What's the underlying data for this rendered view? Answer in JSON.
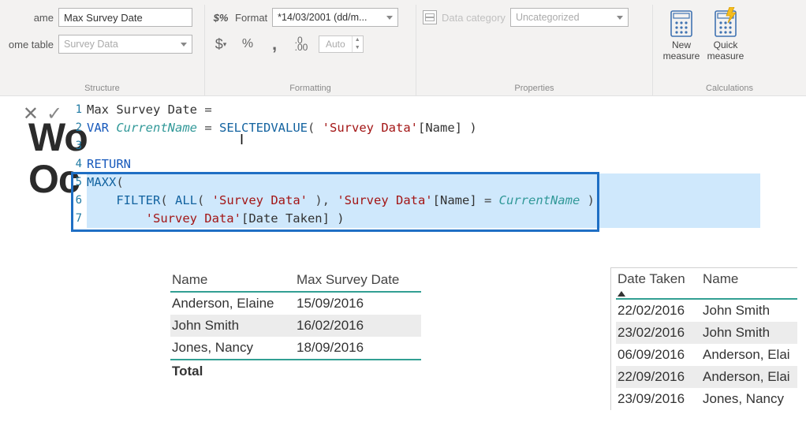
{
  "ribbon": {
    "structure": {
      "name_label": "ame",
      "name_value": "Max Survey Date",
      "home_table_label": "ome table",
      "home_table_value": "Survey Data",
      "group_label": "Structure"
    },
    "formatting": {
      "format_sym": "$%",
      "format_label": "Format",
      "format_value": "*14/03/2001 (dd/m...",
      "dollar": "$",
      "percent": "%",
      "comma": ",",
      "decimal": ".00",
      "spinner": "Auto",
      "group_label": "Formatting"
    },
    "properties": {
      "category_label": "Data category",
      "category_value": "Uncategorized",
      "group_label": "Properties"
    },
    "calculations": {
      "new_measure": "New measure",
      "quick_measure": "Quick measure",
      "group_label": "Calculations"
    }
  },
  "bg": {
    "line1": "Wo",
    "line2": "Oc"
  },
  "formula": {
    "l1_a": "Max Survey Date ",
    "l1_b": "=",
    "l2_var": "VAR",
    "l2_ident": " CurrentName ",
    "l2_eq": "= ",
    "l2_fn": "SEL",
    "l2_fn_rest": "CTEDVALUE",
    "l2_args": "( ",
    "l2_str": "'Survey Data'",
    "l2_col": "[Name] )",
    "l4_ret": "RETURN",
    "l5_fn": "MAXX",
    "l5_open": "(",
    "l6_pad": "    ",
    "l6_fn1": "FILTER",
    "l6_open": "( ",
    "l6_fn2": "ALL",
    "l6_args1": "( ",
    "l6_str1": "'Survey Data'",
    "l6_mid": " ), ",
    "l6_str2": "'Survey Data'",
    "l6_col": "[Name] ",
    "l6_eq": "= ",
    "l6_ident": "CurrentName",
    "l6_close": " ),",
    "l7_pad": "        ",
    "l7_str": "'Survey Data'",
    "l7_col": "[Date Taken] )"
  },
  "table1": {
    "h1": "Name",
    "h2": "Max Survey Date",
    "rows": [
      {
        "name": "Anderson, Elaine",
        "date": "15/09/2016"
      },
      {
        "name": "John Smith",
        "date": "16/02/2016"
      },
      {
        "name": "Jones, Nancy",
        "date": "18/09/2016"
      }
    ],
    "total": "Total"
  },
  "table2": {
    "h1": "Date Taken",
    "h2": "Name",
    "rows": [
      {
        "date": "22/02/2016",
        "name": "John Smith"
      },
      {
        "date": "23/02/2016",
        "name": "John Smith"
      },
      {
        "date": "06/09/2016",
        "name": "Anderson, Elai"
      },
      {
        "date": "22/09/2016",
        "name": "Anderson, Elai"
      },
      {
        "date": "23/09/2016",
        "name": "Jones, Nancy"
      }
    ]
  }
}
